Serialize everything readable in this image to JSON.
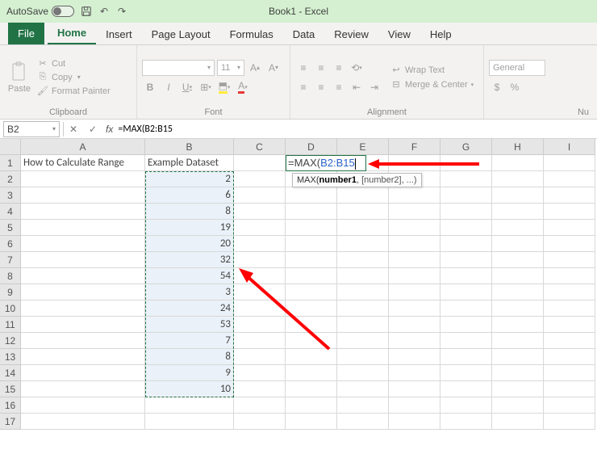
{
  "titlebar": {
    "autosave": "AutoSave",
    "title": "Book1 - Excel"
  },
  "tabs": {
    "file": "File",
    "items": [
      "Home",
      "Insert",
      "Page Layout",
      "Formulas",
      "Data",
      "Review",
      "View",
      "Help"
    ],
    "active": 0
  },
  "ribbon": {
    "clipboard": {
      "paste": "Paste",
      "cut": "Cut",
      "copy": "Copy",
      "format_painter": "Format Painter",
      "label": "Clipboard"
    },
    "font": {
      "size": "11",
      "bold": "B",
      "italic": "I",
      "underline": "U",
      "label": "Font"
    },
    "alignment": {
      "wrap": "Wrap Text",
      "merge": "Merge & Center",
      "label": "Alignment"
    },
    "number": {
      "format": "General",
      "currency": "$",
      "percent": "%",
      "label": "Nu"
    }
  },
  "formula_bar": {
    "namebox": "B2",
    "formula": "=MAX(B2:B15"
  },
  "columns": [
    "A",
    "B",
    "C",
    "D",
    "E",
    "F",
    "G",
    "H",
    "I"
  ],
  "col_widths": {
    "A": 154,
    "B": 110,
    "C": 64,
    "D": 64,
    "E": 64,
    "F": 64,
    "G": 64,
    "H": 64,
    "I": 64
  },
  "rows": 17,
  "cells": {
    "A1": "How to Calculate Range",
    "B1": "Example Dataset",
    "B2": "2",
    "B3": "6",
    "B4": "8",
    "B5": "19",
    "B6": "20",
    "B7": "32",
    "B8": "54",
    "B9": "3",
    "B10": "24",
    "B11": "53",
    "B12": "7",
    "B13": "8",
    "B14": "9",
    "B15": "10"
  },
  "edit": {
    "cell": "D1",
    "prefix": "=MAX(",
    "ref": "B2:B15",
    "tooltip_fn": "MAX(",
    "tooltip_bold": "number1",
    "tooltip_rest": ", [number2], ...)"
  },
  "selection_range": "B2:B15",
  "chart_data": {
    "type": "table",
    "title": "Example Dataset",
    "categories": [
      "B2",
      "B3",
      "B4",
      "B5",
      "B6",
      "B7",
      "B8",
      "B9",
      "B10",
      "B11",
      "B12",
      "B13",
      "B14",
      "B15"
    ],
    "values": [
      2,
      6,
      8,
      19,
      20,
      32,
      54,
      3,
      24,
      53,
      7,
      8,
      9,
      10
    ]
  }
}
